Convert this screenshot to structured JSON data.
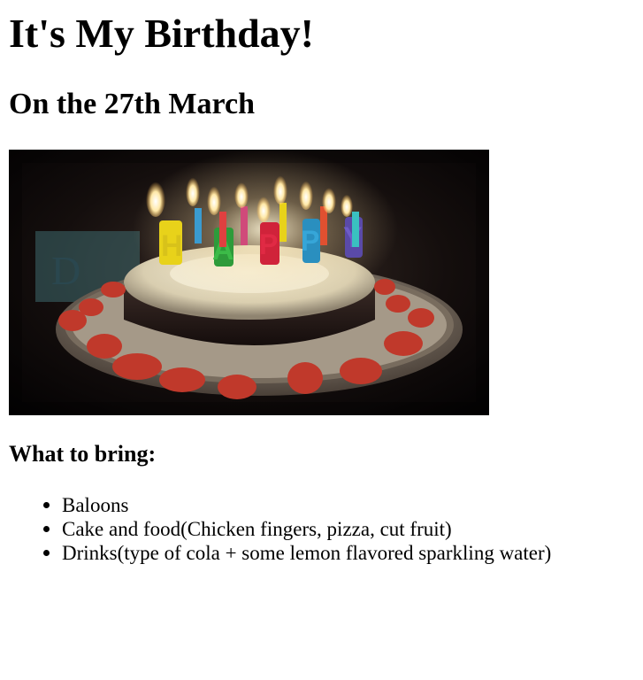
{
  "page": {
    "title": "It's My Birthday!",
    "subtitle": "On the 27th March",
    "image": {
      "icon": "birthday-cake-photo",
      "candle_letters": [
        "H",
        "A",
        "P",
        "P",
        "Y"
      ]
    },
    "bring_heading": "What to bring:",
    "bring_items": [
      "Baloons",
      "Cake and food(Chicken fingers, pizza, cut fruit)",
      "Drinks(type of cola + some lemon flavored sparkling water)"
    ]
  },
  "colors": {
    "text": "#000000",
    "background": "#ffffff",
    "cake_frosting": "#e9e2c8",
    "cake_sponge": "#2b1f1c",
    "strawberry": "#c0392b"
  }
}
